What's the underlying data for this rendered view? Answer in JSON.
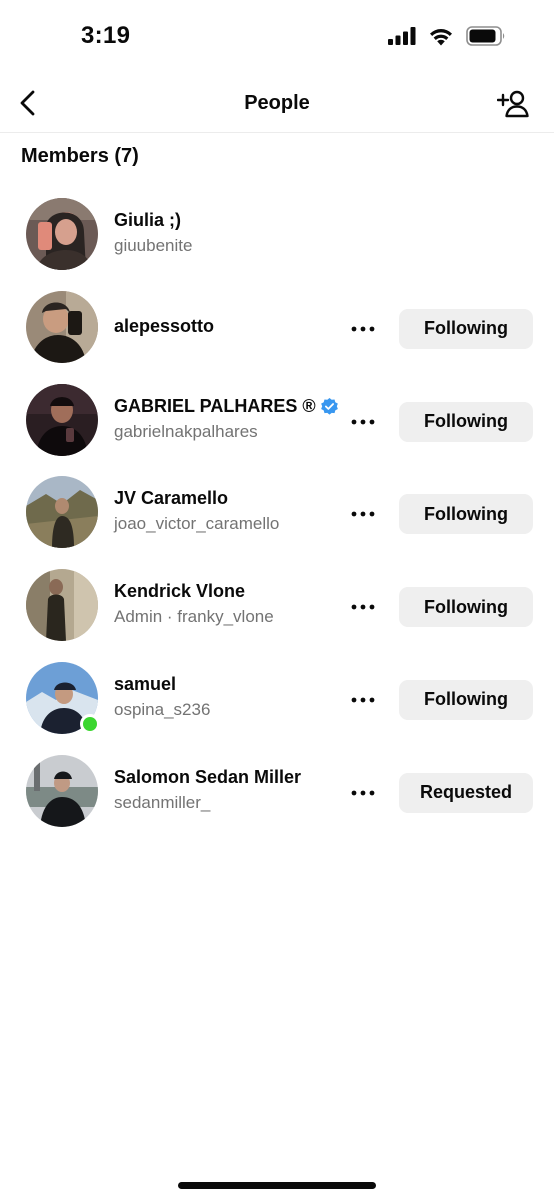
{
  "status_bar": {
    "time": "3:19"
  },
  "nav": {
    "title": "People"
  },
  "members_section": {
    "title": "Members (7)"
  },
  "members": [
    {
      "name": "Giulia ;)",
      "subtitle": "giuubenite",
      "action": "",
      "verified": false,
      "online": false,
      "avatar_colors": [
        "#6b5a55",
        "#c28a7a",
        "#2a2422"
      ]
    },
    {
      "name": "alepessotto",
      "subtitle": "",
      "action": "Following",
      "verified": false,
      "online": false,
      "avatar_colors": [
        "#9a8a78",
        "#4a3c30",
        "#1c1814"
      ]
    },
    {
      "name": "GABRIEL PALHARES ®",
      "subtitle": "gabrielnakpalhares",
      "action": "Following",
      "verified": true,
      "online": false,
      "avatar_colors": [
        "#2a1e22",
        "#5a3a3e",
        "#0e0a0c"
      ]
    },
    {
      "name": "JV Caramello",
      "subtitle": "joao_victor_caramello",
      "action": "Following",
      "verified": false,
      "online": false,
      "avatar_colors": [
        "#a9b7c6",
        "#6f6a4c",
        "#2e2a22"
      ]
    },
    {
      "name": "Kendrick Vlone",
      "subtitle": "Admin · franky_vlone",
      "action": "Following",
      "verified": false,
      "online": false,
      "avatar_colors": [
        "#b4a890",
        "#5a5242",
        "#2a261e"
      ]
    },
    {
      "name": "samuel",
      "subtitle": "ospina_s236",
      "action": "Following",
      "verified": false,
      "online": true,
      "avatar_colors": [
        "#6d9fd6",
        "#d9e4ee",
        "#1b2130"
      ]
    },
    {
      "name": "Salomon Sedan Miller",
      "subtitle": "sedanmiller_",
      "action": "Requested",
      "verified": false,
      "online": false,
      "avatar_colors": [
        "#c9ccd0",
        "#7d8a86",
        "#15171a"
      ]
    }
  ],
  "icons": {
    "back": "chevron-left-icon",
    "add_people": "add-person-icon",
    "more": "more-horizontal-icon",
    "verified": "verified-badge-icon",
    "verified_color": "#3897f0",
    "online_color": "#3bd62f"
  }
}
